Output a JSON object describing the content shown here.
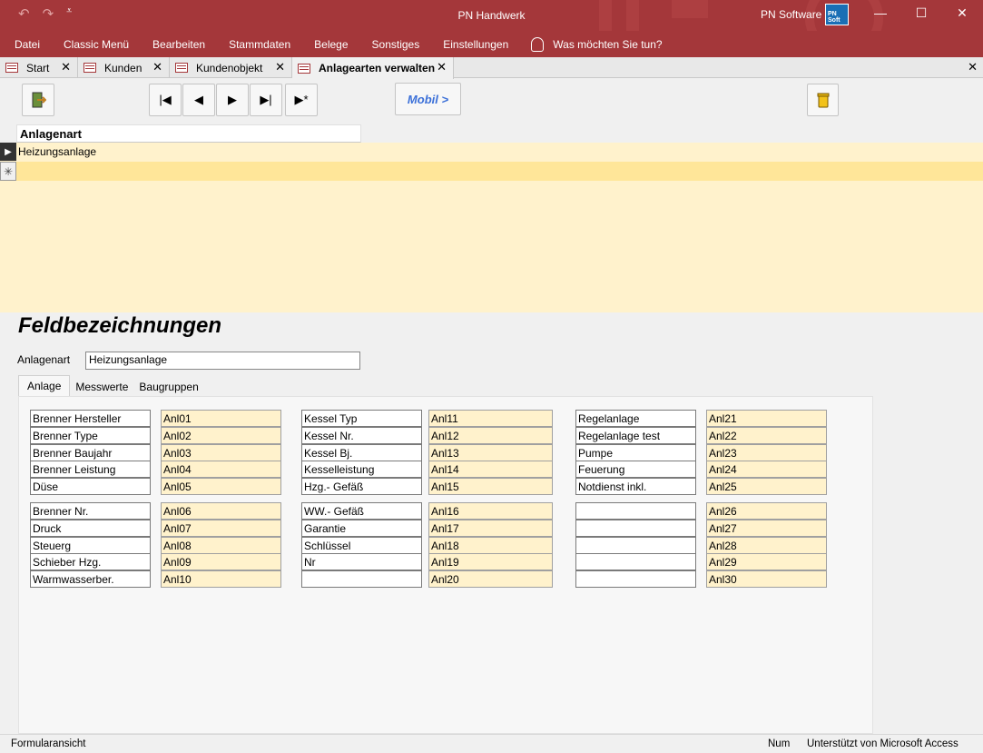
{
  "window": {
    "title": "PN Handwerk",
    "brand": "PN Software",
    "brand_logo_text": "PN Soft"
  },
  "menu": [
    "Datei",
    "Classic Menü",
    "Bearbeiten",
    "Stammdaten",
    "Belege",
    "Sonstiges",
    "Einstellungen"
  ],
  "tell_me": "Was möchten Sie tun?",
  "doc_tabs": [
    {
      "label": "Start"
    },
    {
      "label": "Kunden"
    },
    {
      "label": "Kundenobjekt"
    },
    {
      "label": "Anlagearten verwalten",
      "active": true
    }
  ],
  "toolbar": {
    "mobil_label": "Mobil >"
  },
  "datasheet": {
    "header": "Anlagenart",
    "rows": [
      "Heizungsanlage"
    ]
  },
  "form": {
    "title": "Feldbezeichnungen",
    "anlagenart_label": "Anlagenart",
    "anlagenart_value": "Heizungsanlage",
    "tabs": [
      "Anlage",
      "Messwerte",
      "Baugruppen"
    ],
    "active_tab": "Anlage"
  },
  "fields": [
    {
      "label": "Brenner Hersteller",
      "code": "Anl01"
    },
    {
      "label": "Brenner Type",
      "code": "Anl02"
    },
    {
      "label": "Brenner Baujahr",
      "code": "Anl03"
    },
    {
      "label": "Brenner Leistung",
      "code": "Anl04"
    },
    {
      "label": "Düse",
      "code": "Anl05"
    },
    {
      "label": "Brenner Nr.",
      "code": "Anl06"
    },
    {
      "label": "Druck",
      "code": "Anl07"
    },
    {
      "label": "Steuerg",
      "code": "Anl08"
    },
    {
      "label": "Schieber Hzg.",
      "code": "Anl09"
    },
    {
      "label": "Warmwasserber.",
      "code": "Anl10"
    },
    {
      "label": "Kessel Typ",
      "code": "Anl11"
    },
    {
      "label": "Kessel Nr.",
      "code": "Anl12"
    },
    {
      "label": "Kessel Bj.",
      "code": "Anl13"
    },
    {
      "label": "Kesselleistung",
      "code": "Anl14"
    },
    {
      "label": "Hzg.- Gefäß",
      "code": "Anl15"
    },
    {
      "label": "WW.- Gefäß",
      "code": "Anl16"
    },
    {
      "label": "Garantie",
      "code": "Anl17"
    },
    {
      "label": "Schlüssel",
      "code": "Anl18"
    },
    {
      "label": "Nr",
      "code": "Anl19"
    },
    {
      "label": "",
      "code": "Anl20"
    },
    {
      "label": "Regelanlage",
      "code": "Anl21"
    },
    {
      "label": "Regelanlage test",
      "code": "Anl22"
    },
    {
      "label": "Pumpe",
      "code": "Anl23"
    },
    {
      "label": "Feuerung",
      "code": "Anl24"
    },
    {
      "label": "Notdienst inkl.",
      "code": "Anl25"
    },
    {
      "label": "",
      "code": "Anl26"
    },
    {
      "label": "",
      "code": "Anl27"
    },
    {
      "label": "",
      "code": "Anl28"
    },
    {
      "label": "",
      "code": "Anl29"
    },
    {
      "label": "",
      "code": "Anl30"
    }
  ],
  "status": {
    "left": "Formularansicht",
    "num": "Num",
    "right": "Unterstützt von Microsoft Access"
  }
}
